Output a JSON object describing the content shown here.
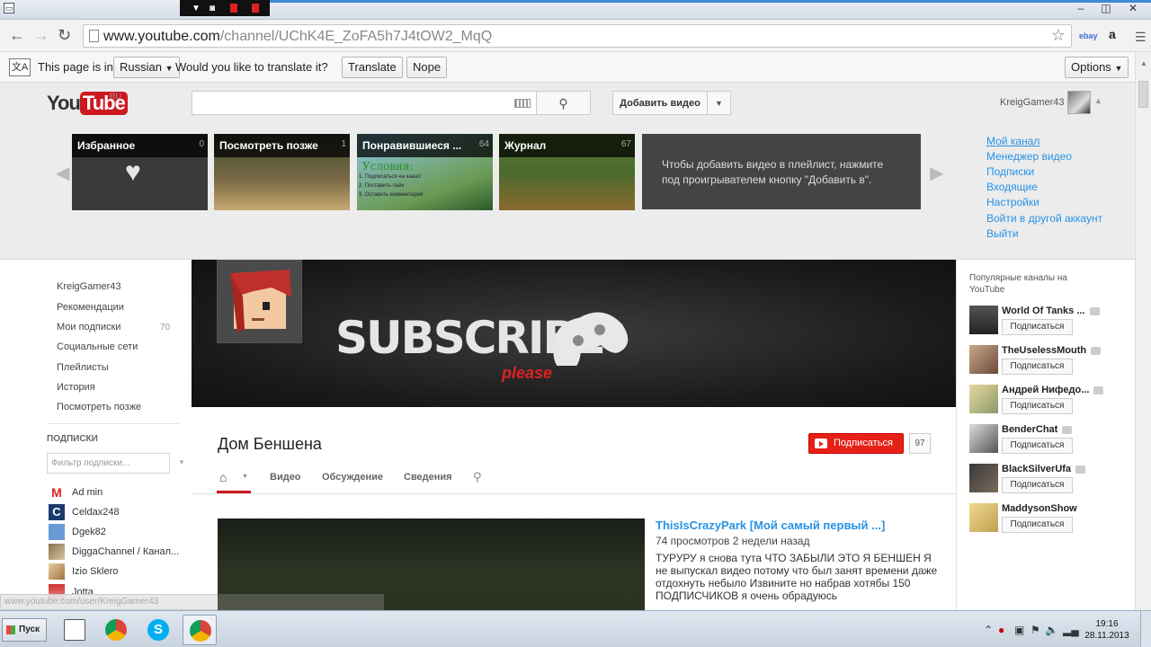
{
  "browser": {
    "url_host": "www.youtube.com",
    "url_path": "/channel/UChK4E_ZoFA5h7J4tOW2_MqQ",
    "window_buttons": {
      "minimize": "–",
      "restore": "◫",
      "close": "✕"
    },
    "ext_ebay": "ebay",
    "ext_amazon": "a"
  },
  "translate_bar": {
    "prefix": "This page is in",
    "language": "Russian",
    "question": "Would you like to translate it?",
    "translate_label": "Translate",
    "nope_label": "Nope",
    "options_label": "Options"
  },
  "youtube": {
    "logo_you": "You",
    "logo_tube": "Tube",
    "logo_region": "RU",
    "search_placeholder": "",
    "upload_label": "Добавить видео",
    "username": "KreigGamer43",
    "playlists": [
      {
        "title": "Избранное",
        "count": "0"
      },
      {
        "title": "Посмотреть позже",
        "count": "1"
      },
      {
        "title": "Понравившиеся ...",
        "count": "64"
      },
      {
        "title": "Журнал",
        "count": "67"
      }
    ],
    "playlist_hint": "Чтобы добавить видео в плейлист, нажмите под проигрывателем кнопку \"Добавить в\".",
    "thumb_text_lines": [
      "Условия:",
      "1. Подписаться на канал",
      "2. Поставить лайк",
      "3. Оставить комментарий"
    ],
    "account_menu": [
      "Мой канал",
      "Менеджер видео",
      "Подписки",
      "Входящие",
      "Настройки",
      "Войти в другой аккаунт",
      "Выйти"
    ]
  },
  "guide": {
    "items": [
      {
        "label": "KreigGamer43",
        "count": ""
      },
      {
        "label": "Рекомендации",
        "count": ""
      },
      {
        "label": "Мои подписки",
        "count": "70"
      },
      {
        "label": "Социальные сети",
        "count": ""
      },
      {
        "label": "Плейлисты",
        "count": ""
      },
      {
        "label": "История",
        "count": ""
      },
      {
        "label": "Посмотреть позже",
        "count": ""
      }
    ],
    "subs_heading": "ПОДПИСКИ",
    "filter_placeholder": "Фильтр подписки...",
    "subscriptions": [
      "Ad min",
      "Celdax248",
      "Dgek82",
      "DiggaChannel / Канал...",
      "Izio Sklero",
      "Jotta"
    ],
    "status_url": "www.youtube.com/user/KreigGamer43"
  },
  "channel": {
    "banner_text": "SUBSCRIBE",
    "banner_sub": "please",
    "title": "Дом Беншена",
    "subscribe_label": "Подписаться",
    "subscriber_count": "97",
    "tabs": [
      "Видео",
      "Обсуждение",
      "Сведения"
    ],
    "video": {
      "title": "ThisIsCrazyPark [Мой самый первый ...]",
      "views": "74 просмотров",
      "age": "2 недели назад",
      "description": "ТУРУРУ я снова тута ЧТО ЗАБЫЛИ ЭТО Я БЕНШЕН Я не выпускал видео потому что был занят времени даже отдохнуть небыло Извините но набрав хотябы 150 ПОДПИСЧИКОВ я очень обрадуюсь"
    }
  },
  "popular": {
    "heading": "Популярные каналы на YouTube",
    "subscribe_label": "Подписаться",
    "channels": [
      "World Of Tanks ...",
      "TheUselessMouth",
      "Андрей Нифедо...",
      "BenderChat",
      "BlackSilverUfa",
      "MaddysonShow"
    ]
  },
  "taskbar": {
    "start_label": "Пуск",
    "time": "19:16",
    "date": "28.11.2013"
  },
  "colors": {
    "youtube_red": "#cc181e",
    "link_blue": "#2793e6",
    "subscribe_red": "#e62117"
  }
}
